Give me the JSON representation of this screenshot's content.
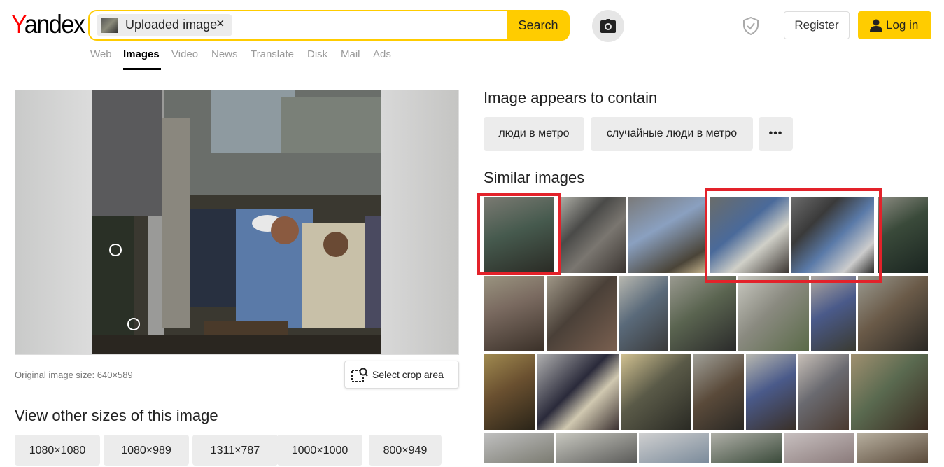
{
  "header": {
    "logo_first": "Y",
    "logo_rest": "andex",
    "search_chip_label": "Uploaded image",
    "search_chip_close": "×",
    "search_button": "Search",
    "register_button": "Register",
    "login_button": "Log in",
    "brand_color": "#ffcc00",
    "logo_accent": "#ff0000"
  },
  "nav": {
    "items": [
      "Web",
      "Images",
      "Video",
      "News",
      "Translate",
      "Disk",
      "Mail",
      "Ads"
    ],
    "active": "Images"
  },
  "left": {
    "original_size": "Original image size: 640×589",
    "crop_button": "Select crop area",
    "other_sizes_title": "View other sizes of this image",
    "sizes": [
      "1080×1080",
      "1080×989",
      "1311×787",
      "1000×1000",
      "800×949"
    ]
  },
  "right": {
    "contains_title": "Image appears to contain",
    "tags": [
      "люди в метро",
      "случайные люди в метро"
    ],
    "more_tags": "•••",
    "similar_title": "Similar images",
    "highlight_color": "#e3222a"
  },
  "icons": [
    "camera-icon",
    "shield-icon",
    "user-icon",
    "crop-icon",
    "close-icon",
    "more-icon"
  ]
}
